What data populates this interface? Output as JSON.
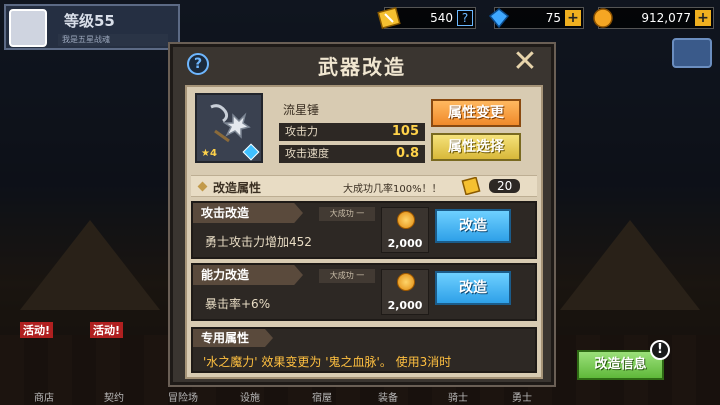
{
  "topbar": {
    "level_label": "等级55",
    "xp_text": "我是五星战魂",
    "tickets": "540",
    "gems": "75",
    "gold": "912,077"
  },
  "bottom_nav": [
    "商店",
    "契约",
    "冒险场",
    "设施",
    "宿屋",
    "装备",
    "骑士",
    "勇士"
  ],
  "events": [
    "活动!",
    "活动!"
  ],
  "dialog": {
    "title": "武器改造",
    "weapon": {
      "name": "流星锤",
      "stars": "★4",
      "stats": [
        {
          "label": "攻击力",
          "value": "105"
        },
        {
          "label": "攻击速度",
          "value": "0.8"
        }
      ]
    },
    "buttons": {
      "change_attr": "属性变更",
      "select_attr": "属性选择"
    },
    "section": {
      "label": "改造属性",
      "rate_text": "大成功几率100%！！",
      "ticket_count": "20"
    },
    "reforms": [
      {
        "title": "攻击改造",
        "great": "大成功 一",
        "desc": "勇士攻击力增加452",
        "cost": "2,000",
        "button": "改造"
      },
      {
        "title": "能力改造",
        "great": "大成功 一",
        "desc": "暴击率+6%",
        "cost": "2,000",
        "button": "改造"
      }
    ],
    "special": {
      "title": "专用属性",
      "desc": "'水之魔力' 效果变更为 '鬼之血脉'。 使用3消时"
    }
  },
  "info_button": "改造信息",
  "colors": {
    "accent_orange": "#f08a2a",
    "accent_blue": "#2ea0e8",
    "accent_green": "#5fb83a",
    "panel": "#d8cbb2"
  }
}
